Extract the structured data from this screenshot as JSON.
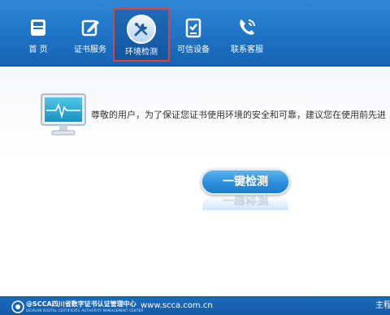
{
  "toolbar": {
    "items": [
      {
        "label": "首 页",
        "icon": "home-icon"
      },
      {
        "label": "证书服务",
        "icon": "certificate-edit-icon"
      },
      {
        "label": "环境检测",
        "icon": "tools-icon",
        "active": true
      },
      {
        "label": "可信设备",
        "icon": "trusted-device-icon"
      },
      {
        "label": "联系客服",
        "icon": "phone-icon"
      }
    ]
  },
  "main": {
    "notice": "尊敬的用户，为了保证您证书使用环境的安全和可靠，建议您在使用前先进",
    "check_button": "一键检测",
    "monitor_icon": "monitor-heartbeat-icon"
  },
  "footer": {
    "logo_text": "@SCCA四川省数字证书认证管理中心",
    "logo_subtext": "SICHUAN DIGITAL CERTIFICATE AUTHORITY MANAGEMENT CENTER",
    "url": "www.scca.com.cn",
    "right_text": "主程"
  },
  "colors": {
    "toolbar": "#1f73c4",
    "active_border": "#d8453f",
    "button": "#2a8ddb",
    "footer": "#145aa6"
  }
}
